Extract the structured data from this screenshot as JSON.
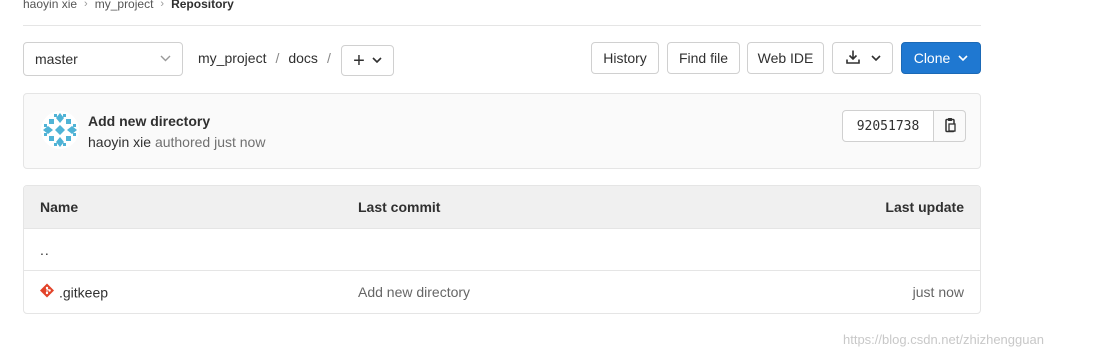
{
  "breadcrumb": {
    "user": "haoyin xie",
    "project": "my_project",
    "current": "Repository",
    "separator": "›"
  },
  "toolbar": {
    "branch": "master",
    "path": [
      "my_project",
      "docs"
    ],
    "path_separator": "/",
    "add_symbol": "+",
    "history_label": "History",
    "find_file_label": "Find file",
    "web_ide_label": "Web IDE",
    "clone_label": "Clone",
    "clone_color": "#1f78d1"
  },
  "commit": {
    "title": "Add new directory",
    "author": "haoyin xie",
    "authored_text": "authored just now",
    "sha": "92051738",
    "avatar_color": "#4fb3d6"
  },
  "tree": {
    "headers": {
      "name": "Name",
      "last_commit": "Last commit",
      "last_update": "Last update"
    },
    "up_dir": "..",
    "files": [
      {
        "name": ".gitkeep",
        "last_commit": "Add new directory",
        "last_update": "just now",
        "icon": "git-icon",
        "icon_color": "#e24329"
      }
    ]
  },
  "watermark": "https://blog.csdn.net/zhizhengguan"
}
